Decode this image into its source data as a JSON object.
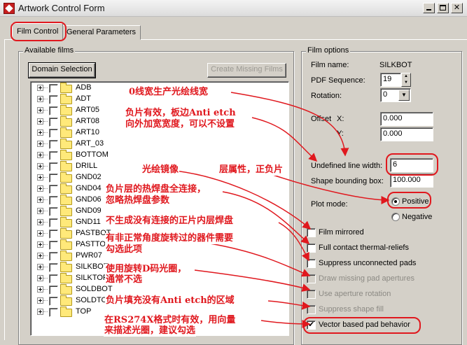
{
  "window": {
    "title": "Artwork Control Form"
  },
  "tabs": [
    {
      "label": "Film Control"
    },
    {
      "label": "General Parameters"
    }
  ],
  "available_films": {
    "title": "Available films",
    "domain_button": "Domain Selection",
    "create_button": "Create Missing Films",
    "films": [
      "ADB",
      "ADT",
      "ART05",
      "ART08",
      "ART10",
      "ART_03",
      "BOTTOM",
      "DRILL",
      "GND02",
      "GND04",
      "GND06",
      "GND09",
      "GND11",
      "PASTBOT",
      "PASTTOP",
      "PWR07",
      "SILKBOT",
      "SILKTOP",
      "SOLDBOT",
      "SOLDTOP",
      "TOP"
    ]
  },
  "film_options": {
    "title": "Film options",
    "film_name_label": "Film name:",
    "film_name_value": "SILKBOT",
    "pdf_sequence_label": "PDF Sequence:",
    "pdf_sequence_value": "19",
    "rotation_label": "Rotation:",
    "rotation_value": "0",
    "offset_label": "Offset",
    "offset_x_label": "X:",
    "offset_x_value": "0.000",
    "offset_y_label": "Y:",
    "offset_y_value": "0.000",
    "undefined_line_width_label": "Undefined line width:",
    "undefined_line_width_value": "6",
    "shape_bounding_box_label": "Shape bounding box:",
    "shape_bounding_box_value": "100.000",
    "plot_mode_label": "Plot mode:",
    "positive_label": "Positive",
    "negative_label": "Negative",
    "checkboxes": {
      "film_mirrored": "Film mirrored",
      "full_contact": "Full contact thermal-reliefs",
      "suppress_unconnected": "Suppress unconnected pads",
      "draw_missing": "Draw missing pad apertures",
      "use_aperture_rotation": "Use aperture rotation",
      "suppress_shape_fill": "Suppress shape fill",
      "vector_based": "Vector based pad behavior"
    }
  },
  "annotations": {
    "a1": "0线宽生产光绘线宽",
    "a2_line1": "负片有效，板边Anti etch",
    "a2_line2": "向外加宽宽度，可以不设置",
    "a3": "光绘镜像",
    "a4": "层属性，正负片",
    "a5_line1": "负片层的热焊盘全连接，",
    "a5_line2": "忽略热焊盘参数",
    "a6": "不生成没有连接的正片内层焊盘",
    "a7_line1": "有非正常角度旋转过的器件需要",
    "a7_line2": "勾选此项",
    "a8_line1": "使用旋转D码光圈，",
    "a8_line2": "通常不选",
    "a9": "负片填充没有Anti etch的区域",
    "a10_line1": "在RS274X格式时有效，用向量",
    "a10_line2": "来描述光圈，建议勾选"
  },
  "colors": {
    "annotation": "#e0181e",
    "folder": "#ffe97a",
    "dialog": "#d4d0c8"
  }
}
